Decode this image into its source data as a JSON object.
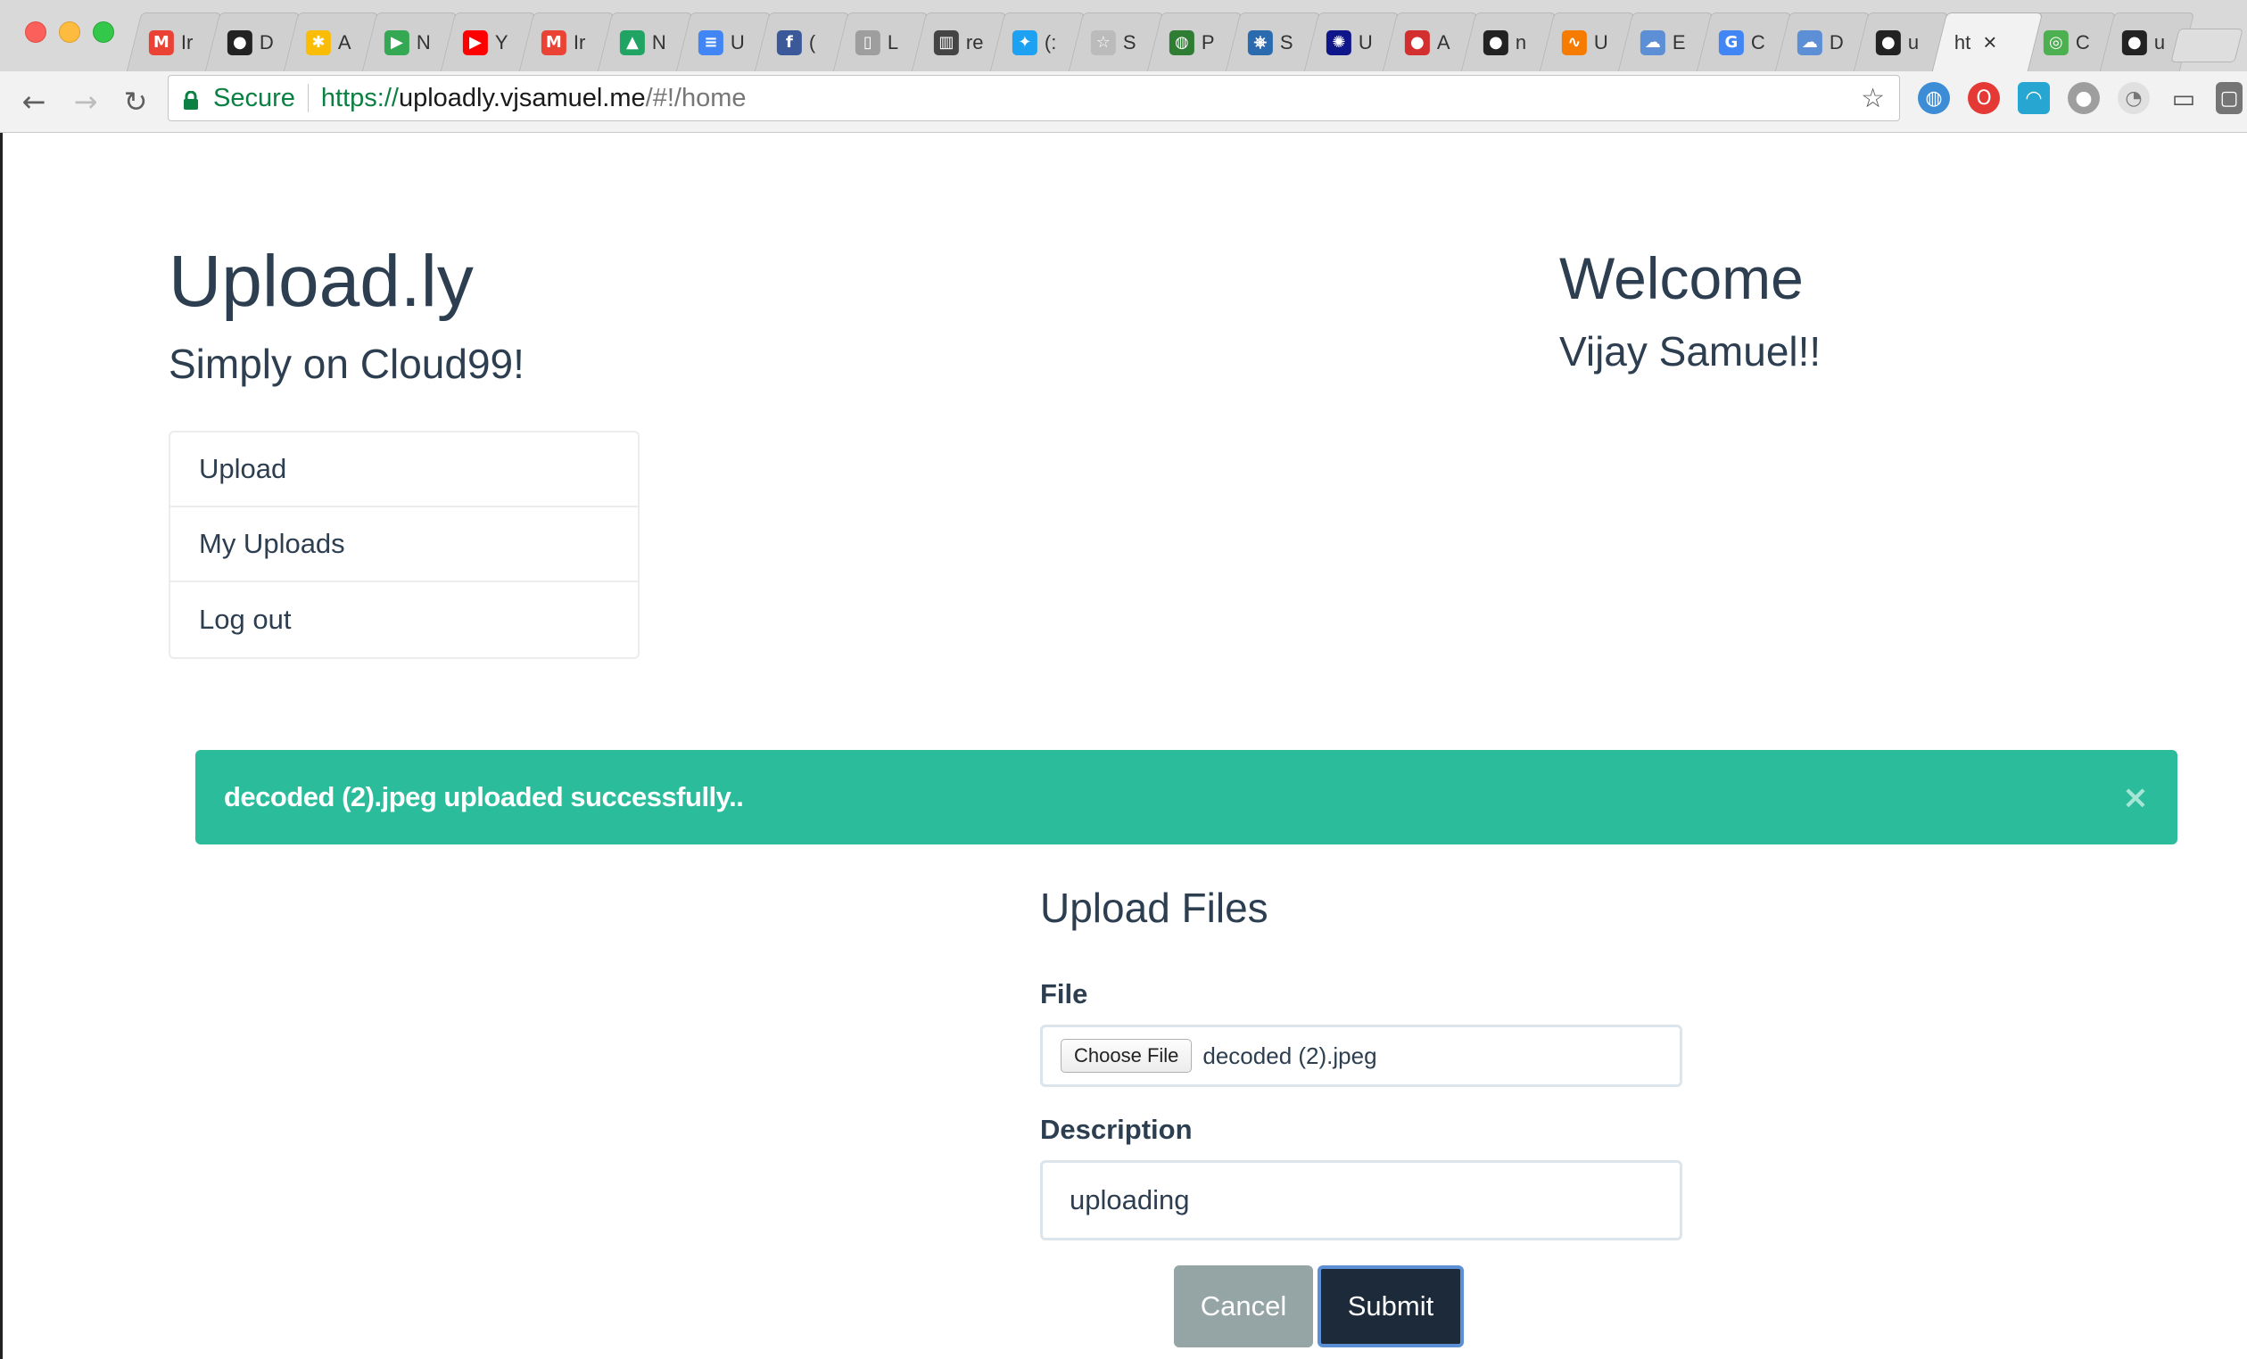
{
  "browser": {
    "tabs": [
      {
        "label": "Ir",
        "icon": "gmail-icon",
        "color": "#ea4335",
        "glyph": "M"
      },
      {
        "label": "D",
        "icon": "github-icon",
        "color": "#222222",
        "glyph": "●"
      },
      {
        "label": "A",
        "icon": "photos-icon",
        "color": "#fbbc05",
        "glyph": "✱"
      },
      {
        "label": "N",
        "icon": "play-icon",
        "color": "#34a853",
        "glyph": "▶"
      },
      {
        "label": "Y",
        "icon": "youtube-icon",
        "color": "#ff0000",
        "glyph": "▶"
      },
      {
        "label": "Ir",
        "icon": "gmail-icon",
        "color": "#ea4335",
        "glyph": "M"
      },
      {
        "label": "N",
        "icon": "drive-icon",
        "color": "#1fa463",
        "glyph": "▲"
      },
      {
        "label": "U",
        "icon": "docs-icon",
        "color": "#4285f4",
        "glyph": "≡"
      },
      {
        "label": "(",
        "icon": "facebook-icon",
        "color": "#3b5998",
        "glyph": "f"
      },
      {
        "label": "L",
        "icon": "document-icon",
        "color": "#9e9e9e",
        "glyph": "▯"
      },
      {
        "label": "re",
        "icon": "chart-icon",
        "color": "#444444",
        "glyph": "▥"
      },
      {
        "label": "(:",
        "icon": "twitter-icon",
        "color": "#1da1f2",
        "glyph": "✦"
      },
      {
        "label": "S",
        "icon": "star-page-icon",
        "color": "#bbbbbb",
        "glyph": "☆"
      },
      {
        "label": "P",
        "icon": "globe-icon",
        "color": "#2e7d32",
        "glyph": "◍"
      },
      {
        "label": "S",
        "icon": "helm-wheel-icon",
        "color": "#2a6bb0",
        "glyph": "⎈"
      },
      {
        "label": "U",
        "icon": "helm-icon",
        "color": "#0f1689",
        "glyph": "✺"
      },
      {
        "label": "A",
        "icon": "red-circle-icon",
        "color": "#d32f2f",
        "glyph": "●"
      },
      {
        "label": "n",
        "icon": "github-icon",
        "color": "#222222",
        "glyph": "●"
      },
      {
        "label": "U",
        "icon": "audio-icon",
        "color": "#f57c00",
        "glyph": "∿"
      },
      {
        "label": "E",
        "icon": "cloud-icon",
        "color": "#5c8fd6",
        "glyph": "☁"
      },
      {
        "label": "C",
        "icon": "google-icon",
        "color": "#4285f4",
        "glyph": "G"
      },
      {
        "label": "D",
        "icon": "cloud-icon",
        "color": "#5c8fd6",
        "glyph": "☁"
      },
      {
        "label": "u",
        "icon": "github-icon",
        "color": "#222222",
        "glyph": "●"
      },
      {
        "label": "ht",
        "icon": "",
        "color": "",
        "glyph": "",
        "active": true,
        "close": "×"
      },
      {
        "label": "C",
        "icon": "chrome-icon",
        "color": "#4caf50",
        "glyph": "◎"
      },
      {
        "label": "u",
        "icon": "github-icon",
        "color": "#222222",
        "glyph": "●"
      }
    ],
    "secure_label": "Secure",
    "url_scheme": "https://",
    "url_host": "uploadly.vjsamuel.me",
    "url_rest": "/#!/home"
  },
  "header": {
    "brand": "Upload.ly",
    "tagline": "Simply on Cloud99!",
    "welcome": "Welcome",
    "user": "Vijay Samuel!!"
  },
  "menu": {
    "items": [
      "Upload",
      "My Uploads",
      "Log out"
    ]
  },
  "alert": {
    "message": "decoded (2).jpeg uploaded successfully..",
    "close": "×",
    "color": "#2abc9b"
  },
  "form": {
    "title": "Upload Files",
    "file_label": "File",
    "choose_label": "Choose File",
    "file_name": "decoded (2).jpeg",
    "description_label": "Description",
    "description_value": "uploading",
    "cancel_label": "Cancel",
    "submit_label": "Submit"
  },
  "colors": {
    "text": "#2c3e50",
    "success": "#2abc9b",
    "cancel": "#95a5a6",
    "submit": "#1c2a3a"
  }
}
